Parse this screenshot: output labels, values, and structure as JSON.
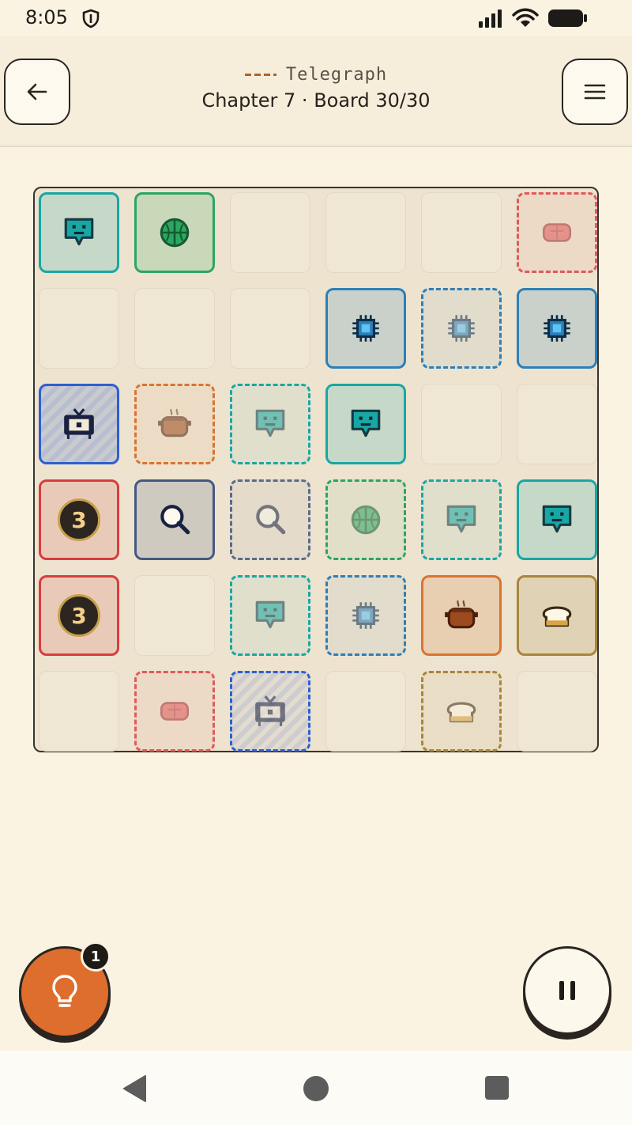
{
  "status": {
    "time": "8:05"
  },
  "header": {
    "subtitle": "Telegraph",
    "title": "Chapter 7 · Board 30/30"
  },
  "board": {
    "rows": 6,
    "cols": 6,
    "cells": [
      [
        {
          "kind": "solid",
          "icon": "chat-icon",
          "color": "#18a7a4"
        },
        {
          "kind": "solid",
          "icon": "globe-icon",
          "color": "#2aa760"
        },
        {
          "kind": "empty"
        },
        {
          "kind": "empty"
        },
        {
          "kind": "empty"
        },
        {
          "kind": "ghost",
          "icon": "steak-icon",
          "color": "#e05a5a"
        }
      ],
      [
        {
          "kind": "empty"
        },
        {
          "kind": "empty"
        },
        {
          "kind": "empty"
        },
        {
          "kind": "solid",
          "icon": "chip-icon",
          "color": "#2d7fb7"
        },
        {
          "kind": "ghost",
          "icon": "chip-icon",
          "color": "#2d7fb7"
        },
        {
          "kind": "solid",
          "icon": "chip-icon",
          "color": "#2d7fb7"
        }
      ],
      [
        {
          "kind": "solid",
          "icon": "tv-icon",
          "color": "#2f5fd0"
        },
        {
          "kind": "ghost",
          "icon": "pot-icon",
          "color": "#d9742f"
        },
        {
          "kind": "ghost",
          "icon": "chat-icon",
          "color": "#18a7a4"
        },
        {
          "kind": "solid",
          "icon": "chat-icon",
          "color": "#18a7a4"
        },
        {
          "kind": "empty"
        },
        {
          "kind": "empty"
        }
      ],
      [
        {
          "kind": "number",
          "value": "3",
          "color": "#d93c3c"
        },
        {
          "kind": "solid",
          "icon": "magnifier-icon",
          "color": "#435a80"
        },
        {
          "kind": "ghost",
          "icon": "magnifier-icon",
          "color": "#5a6b8a"
        },
        {
          "kind": "ghost",
          "icon": "globe-icon",
          "color": "#2aa760"
        },
        {
          "kind": "ghost",
          "icon": "chat-icon",
          "color": "#18a7a4"
        },
        {
          "kind": "solid",
          "icon": "chat-icon",
          "color": "#18a7a4"
        }
      ],
      [
        {
          "kind": "number",
          "value": "3",
          "color": "#d93c3c"
        },
        {
          "kind": "empty"
        },
        {
          "kind": "ghost",
          "icon": "chat-icon",
          "color": "#18a7a4"
        },
        {
          "kind": "ghost",
          "icon": "chip-icon",
          "color": "#2d7fb7"
        },
        {
          "kind": "solid",
          "icon": "pot-icon",
          "color": "#d9742f"
        },
        {
          "kind": "solid",
          "icon": "bread-icon",
          "color": "#a8863c"
        }
      ],
      [
        {
          "kind": "empty"
        },
        {
          "kind": "ghost",
          "icon": "steak-icon",
          "color": "#e05a5a"
        },
        {
          "kind": "ghost",
          "icon": "tv-icon",
          "color": "#2f5fd0"
        },
        {
          "kind": "empty"
        },
        {
          "kind": "ghost",
          "icon": "bread-icon",
          "color": "#a8863c"
        },
        {
          "kind": "empty"
        }
      ]
    ]
  },
  "controls": {
    "hint_icon": "lightbulb-icon",
    "hint_count": "1",
    "pause_icon": "pause-icon"
  },
  "colors": {
    "background": "#fbf3e2",
    "hint_button": "#de6e2e",
    "number_badge": "#2d2620"
  }
}
